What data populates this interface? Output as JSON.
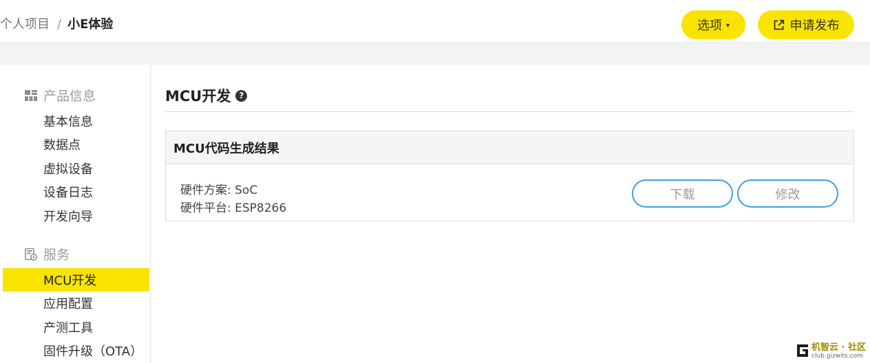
{
  "breadcrumb": {
    "parent": "个人项目",
    "separator": "/",
    "current": "小E体验"
  },
  "header": {
    "options_label": "选项",
    "options_caret": "▾",
    "publish_label": "申请发布"
  },
  "sidebar": {
    "groups": [
      {
        "title": "产品信息",
        "icon": "grid-icon",
        "items": [
          {
            "label": "基本信息",
            "active": false
          },
          {
            "label": "数据点",
            "active": false
          },
          {
            "label": "虚拟设备",
            "active": false
          },
          {
            "label": "设备日志",
            "active": false
          },
          {
            "label": "开发向导",
            "active": false
          }
        ]
      },
      {
        "title": "服务",
        "icon": "service-gear-icon",
        "items": [
          {
            "label": "MCU开发",
            "active": true
          },
          {
            "label": "应用配置",
            "active": false
          },
          {
            "label": "产测工具",
            "active": false
          },
          {
            "label": "固件升级（OTA）",
            "active": false
          }
        ]
      }
    ]
  },
  "main": {
    "title": "MCU开发",
    "help_icon": "?",
    "panel": {
      "title": "MCU代码生成结果",
      "scheme_line": "硬件方案: SoC",
      "platform_line": "硬件平台: ESP8266",
      "download_label": "下载",
      "modify_label": "修改"
    }
  },
  "watermark": {
    "title": "机智云 · 社区",
    "subtitle": "club.gizwits.com"
  },
  "colors": {
    "accent_yellow": "#f9e400",
    "button_border_blue": "#3da0d6",
    "page_gray": "#f3f3f3"
  }
}
